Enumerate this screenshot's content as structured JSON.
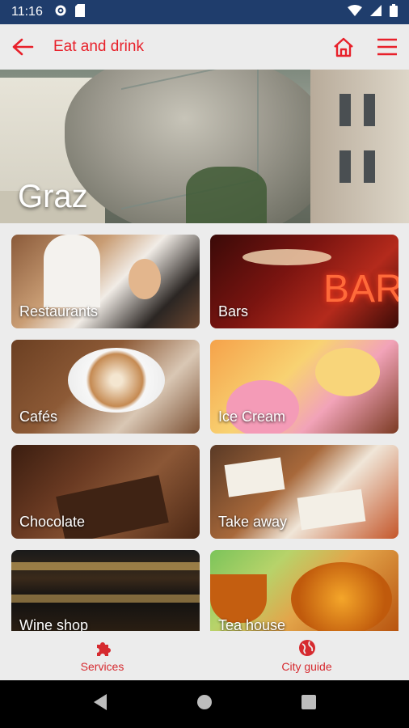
{
  "status_bar": {
    "time": "11:16"
  },
  "app_bar": {
    "title": "Eat and drink"
  },
  "hero": {
    "city": "Graz"
  },
  "categories": [
    {
      "label": "Restaurants"
    },
    {
      "label": "Bars"
    },
    {
      "label": "Cafés"
    },
    {
      "label": "Ice Cream"
    },
    {
      "label": "Chocolate"
    },
    {
      "label": "Take away"
    },
    {
      "label": "Wine shop"
    },
    {
      "label": "Tea house"
    }
  ],
  "bottom_nav": {
    "services": "Services",
    "city_guide": "City guide"
  },
  "colors": {
    "accent": "#e8202a",
    "status_bar": "#1f3d6c",
    "background": "#ececec"
  }
}
